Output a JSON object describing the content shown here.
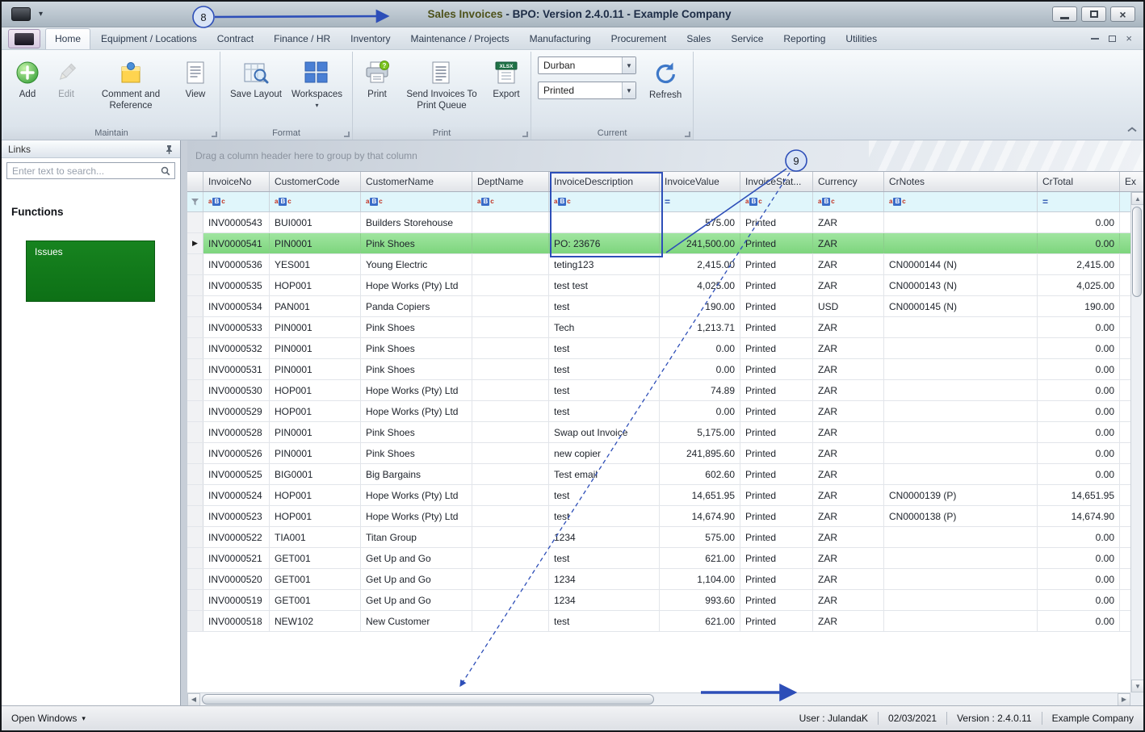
{
  "colors": {
    "annotation_blue": "#2d4eb8",
    "selected_row_green": "#8fdc8f",
    "issues_button_green": "#12791b"
  },
  "window": {
    "title_primary": "Sales Invoices",
    "title_rest": " - BPO: Version 2.4.0.11 - Example Company"
  },
  "ribbon": {
    "active_tab": "Home",
    "tabs": [
      "Home",
      "Equipment / Locations",
      "Contract",
      "Finance / HR",
      "Inventory",
      "Maintenance / Projects",
      "Manufacturing",
      "Procurement",
      "Sales",
      "Service",
      "Reporting",
      "Utilities"
    ],
    "maintain": {
      "label": "Maintain",
      "add": "Add",
      "edit": "Edit",
      "comment": "Comment and Reference",
      "view": "View"
    },
    "format": {
      "label": "Format",
      "save_layout": "Save Layout",
      "workspaces": "Workspaces"
    },
    "print_group": {
      "label": "Print",
      "print": "Print",
      "send_queue": "Send Invoices To Print Queue",
      "export": "Export"
    },
    "current": {
      "label": "Current",
      "branch": "Durban",
      "status": "Printed",
      "refresh": "Refresh"
    }
  },
  "sidebar": {
    "title": "Links",
    "search_placeholder": "Enter text to search...",
    "functions_heading": "Functions",
    "items": [
      {
        "label": "Issues"
      }
    ]
  },
  "grid": {
    "group_hint": "Drag a column header here to group by that column",
    "columns": [
      "InvoiceNo",
      "CustomerCode",
      "CustomerName",
      "DeptName",
      "InvoiceDescription",
      "InvoiceValue",
      "InvoiceStat...",
      "Currency",
      "CrNotes",
      "CrTotal",
      "Ex"
    ],
    "numeric_columns": [
      5,
      9
    ],
    "selected_invoice": "INV0000541",
    "rows": [
      [
        "INV0000543",
        "BUI0001",
        "Builders Storehouse",
        "",
        "",
        "575.00",
        "Printed",
        "ZAR",
        "",
        "0.00"
      ],
      [
        "INV0000541",
        "PIN0001",
        "Pink Shoes",
        "",
        "PO: 23676",
        "241,500.00",
        "Printed",
        "ZAR",
        "",
        "0.00"
      ],
      [
        "INV0000536",
        "YES001",
        "Young Electric",
        "",
        "teting123",
        "2,415.00",
        "Printed",
        "ZAR",
        "CN0000144 (N)",
        "2,415.00"
      ],
      [
        "INV0000535",
        "HOP001",
        "Hope Works (Pty) Ltd",
        "",
        "test test",
        "4,025.00",
        "Printed",
        "ZAR",
        "CN0000143 (N)",
        "4,025.00"
      ],
      [
        "INV0000534",
        "PAN001",
        "Panda Copiers",
        "",
        "test",
        "190.00",
        "Printed",
        "USD",
        "CN0000145 (N)",
        "190.00"
      ],
      [
        "INV0000533",
        "PIN0001",
        "Pink Shoes",
        "",
        "Tech",
        "1,213.71",
        "Printed",
        "ZAR",
        "",
        "0.00"
      ],
      [
        "INV0000532",
        "PIN0001",
        "Pink Shoes",
        "",
        "test",
        "0.00",
        "Printed",
        "ZAR",
        "",
        "0.00"
      ],
      [
        "INV0000531",
        "PIN0001",
        "Pink Shoes",
        "",
        "test",
        "0.00",
        "Printed",
        "ZAR",
        "",
        "0.00"
      ],
      [
        "INV0000530",
        "HOP001",
        "Hope Works (Pty) Ltd",
        "",
        "test",
        "74.89",
        "Printed",
        "ZAR",
        "",
        "0.00"
      ],
      [
        "INV0000529",
        "HOP001",
        "Hope Works (Pty) Ltd",
        "",
        "test",
        "0.00",
        "Printed",
        "ZAR",
        "",
        "0.00"
      ],
      [
        "INV0000528",
        "PIN0001",
        "Pink Shoes",
        "",
        "Swap out Invoice",
        "5,175.00",
        "Printed",
        "ZAR",
        "",
        "0.00"
      ],
      [
        "INV0000526",
        "PIN0001",
        "Pink Shoes",
        "",
        "new copier",
        "241,895.60",
        "Printed",
        "ZAR",
        "",
        "0.00"
      ],
      [
        "INV0000525",
        "BIG0001",
        "Big Bargains",
        "",
        "Test email",
        "602.60",
        "Printed",
        "ZAR",
        "",
        "0.00"
      ],
      [
        "INV0000524",
        "HOP001",
        "Hope Works (Pty) Ltd",
        "",
        "test",
        "14,651.95",
        "Printed",
        "ZAR",
        "CN0000139 (P)",
        "14,651.95"
      ],
      [
        "INV0000523",
        "HOP001",
        "Hope Works (Pty) Ltd",
        "",
        "test",
        "14,674.90",
        "Printed",
        "ZAR",
        "CN0000138 (P)",
        "14,674.90"
      ],
      [
        "INV0000522",
        "TIA001",
        "Titan Group",
        "",
        "1234",
        "575.00",
        "Printed",
        "ZAR",
        "",
        "0.00"
      ],
      [
        "INV0000521",
        "GET001",
        "Get Up and Go",
        "",
        "test",
        "621.00",
        "Printed",
        "ZAR",
        "",
        "0.00"
      ],
      [
        "INV0000520",
        "GET001",
        "Get Up and Go",
        "",
        "1234",
        "1,104.00",
        "Printed",
        "ZAR",
        "",
        "0.00"
      ],
      [
        "INV0000519",
        "GET001",
        "Get Up and Go",
        "",
        "1234",
        "993.60",
        "Printed",
        "ZAR",
        "",
        "0.00"
      ],
      [
        "INV0000518",
        "NEW102",
        "New Customer",
        "",
        "test",
        "621.00",
        "Printed",
        "ZAR",
        "",
        "0.00"
      ]
    ]
  },
  "statusbar": {
    "open_windows": "Open Windows",
    "user": "User : JulandaK",
    "date": "02/03/2021",
    "version": "Version : 2.4.0.11",
    "company": "Example Company"
  },
  "annotations": {
    "callout_8": "8",
    "callout_9": "9"
  }
}
